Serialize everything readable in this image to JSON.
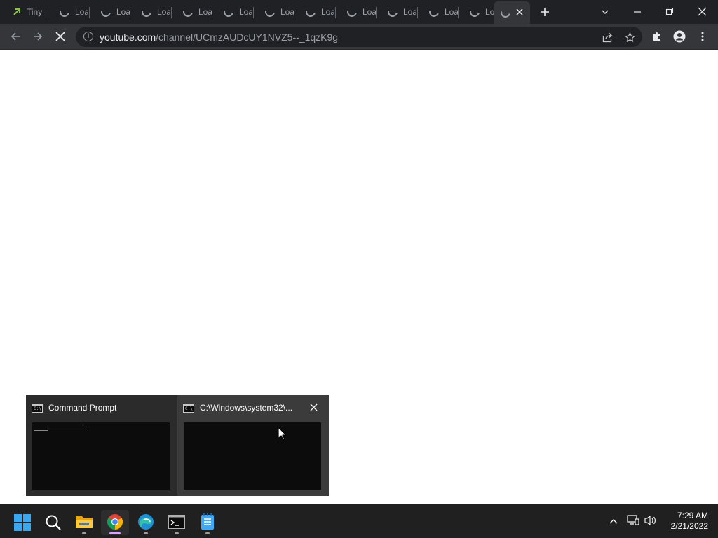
{
  "browser": {
    "tabs": [
      {
        "label": "Tiny",
        "kind": "favicon"
      },
      {
        "label": "Loa",
        "kind": "loading"
      },
      {
        "label": "Loa",
        "kind": "loading"
      },
      {
        "label": "Loa",
        "kind": "loading"
      },
      {
        "label": "Loa",
        "kind": "loading"
      },
      {
        "label": "Loa",
        "kind": "loading"
      },
      {
        "label": "Loa",
        "kind": "loading"
      },
      {
        "label": "Loa",
        "kind": "loading"
      },
      {
        "label": "Loa",
        "kind": "loading"
      },
      {
        "label": "Loa",
        "kind": "loading"
      },
      {
        "label": "Loa",
        "kind": "loading"
      },
      {
        "label": "Lo",
        "kind": "loading"
      },
      {
        "label": "",
        "kind": "active-loading"
      }
    ],
    "new_tab_icon": "plus-icon",
    "window_controls": [
      "tab-search-icon",
      "minimize-icon",
      "restore-icon",
      "close-icon"
    ],
    "address": {
      "host": "youtube.com",
      "path": "/channel/UCmzAUDcUY1NVZ5--_1qzK9g"
    },
    "toolbar_icons": [
      "share-icon",
      "bookmark-star-icon",
      "extensions-icon",
      "profile-icon",
      "menu-icon"
    ]
  },
  "thumbnail_popup": {
    "items": [
      {
        "title": "Command Prompt",
        "icon": "cmd-icon"
      },
      {
        "title": "C:\\Windows\\system32\\...",
        "icon": "cmd-icon"
      }
    ],
    "close_icon": "close-icon",
    "cmd_icon_text": "C:\\_"
  },
  "taskbar": {
    "apps": [
      "start-icon",
      "search-icon",
      "file-explorer-icon",
      "chrome-icon",
      "edge-icon",
      "terminal-icon",
      "notepad-icon"
    ],
    "tray": [
      "chevron-up-icon",
      "network-icon",
      "volume-icon"
    ],
    "time": "7:29 AM",
    "date": "2/21/2022"
  }
}
